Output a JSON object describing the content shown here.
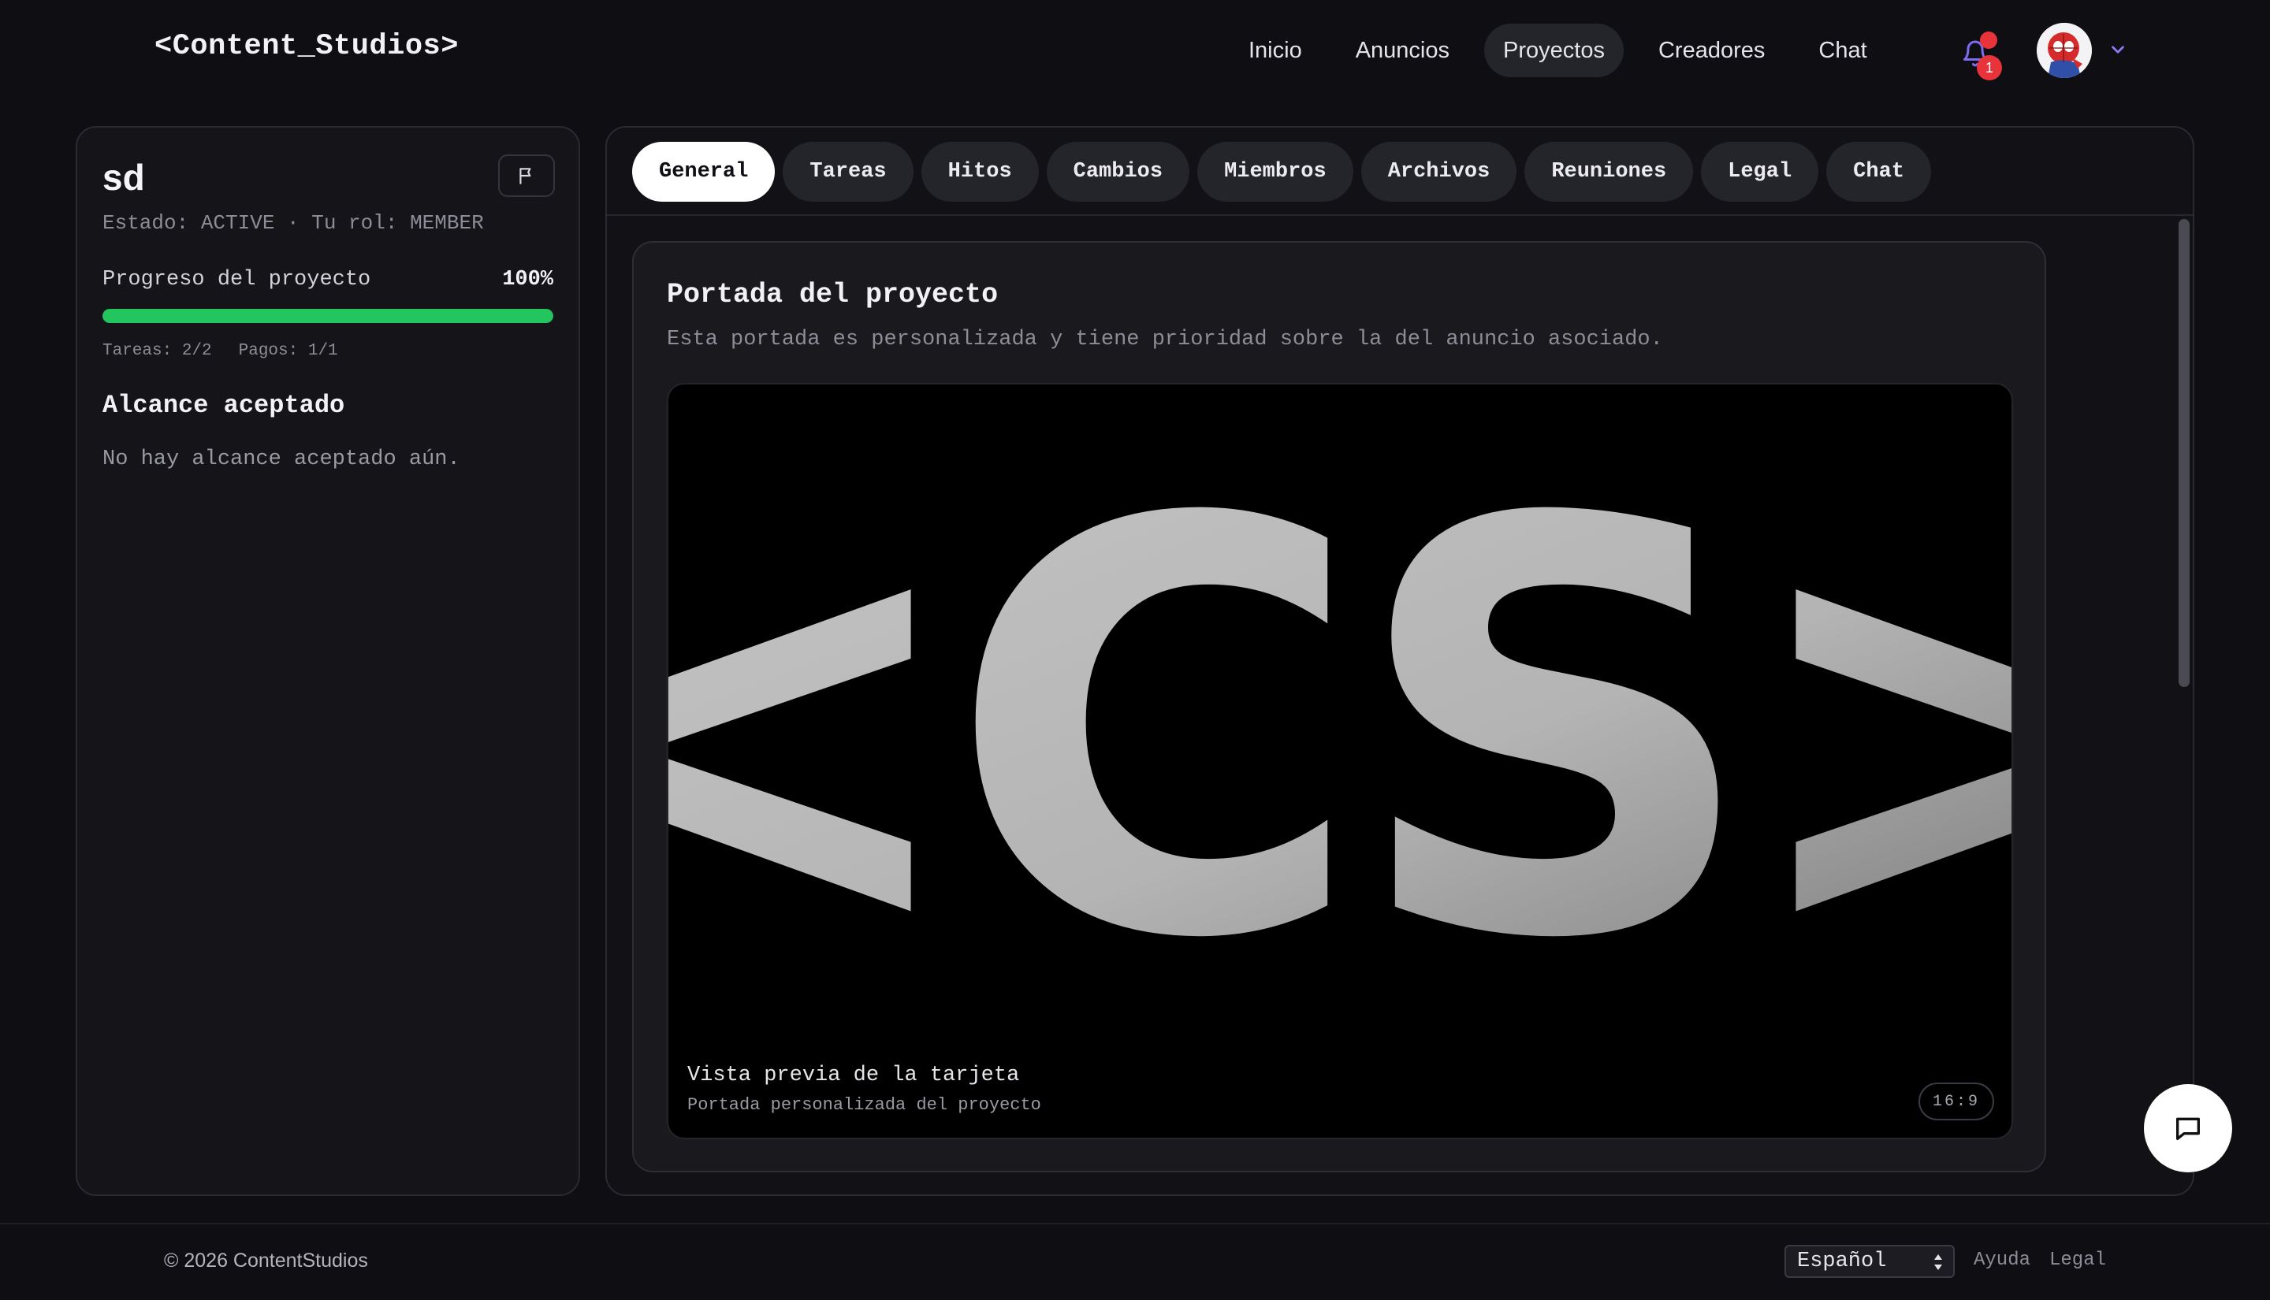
{
  "app": {
    "logo": "<Content_Studios>"
  },
  "nav": {
    "items": [
      {
        "label": "Inicio",
        "active": false
      },
      {
        "label": "Anuncios",
        "active": false
      },
      {
        "label": "Proyectos",
        "active": true
      },
      {
        "label": "Creadores",
        "active": false
      },
      {
        "label": "Chat",
        "active": false
      }
    ],
    "notifications_count": "1"
  },
  "project": {
    "name": "sd",
    "status_line": "Estado: ACTIVE · Tu rol: MEMBER",
    "progress_label": "Progreso del proyecto",
    "progress_value": "100%",
    "progress_fraction": 1.0,
    "tasks_count": "Tareas: 2/2",
    "payments_count": "Pagos: 1/1",
    "scope_title": "Alcance aceptado",
    "scope_empty": "No hay alcance aceptado aún."
  },
  "tabs": [
    {
      "label": "General",
      "active": true
    },
    {
      "label": "Tareas",
      "active": false
    },
    {
      "label": "Hitos",
      "active": false
    },
    {
      "label": "Cambios",
      "active": false
    },
    {
      "label": "Miembros",
      "active": false
    },
    {
      "label": "Archivos",
      "active": false
    },
    {
      "label": "Reuniones",
      "active": false
    },
    {
      "label": "Legal",
      "active": false
    },
    {
      "label": "Chat",
      "active": false
    }
  ],
  "cover": {
    "title": "Portada del proyecto",
    "subtitle": "Esta portada es personalizada y tiene prioridad sobre la del anuncio asociado.",
    "logo_text": "<CS>",
    "preview_title": "Vista previa de la tarjeta",
    "preview_subtitle": "Portada personalizada del proyecto",
    "aspect_ratio": "16:9"
  },
  "footer": {
    "copyright": "© 2026 ContentStudios",
    "language": "Español",
    "help_link": "Ayuda",
    "legal_link": "Legal"
  },
  "colors": {
    "background": "#0e0e13",
    "progress": "#22c55e",
    "badge": "#e8333a"
  }
}
